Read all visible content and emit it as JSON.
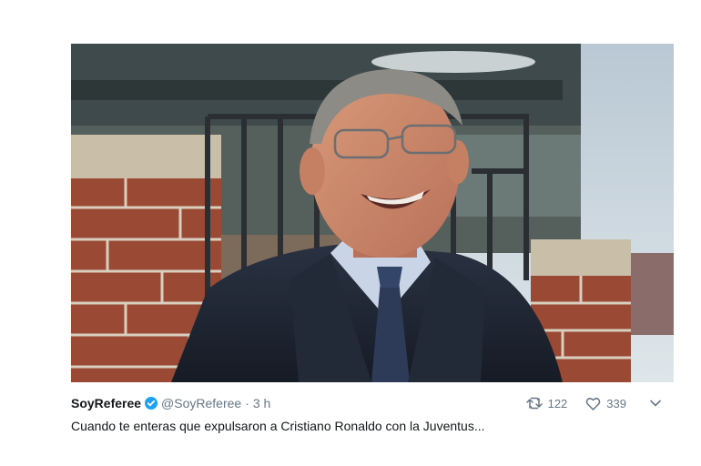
{
  "tweet": {
    "author_name": "SoyReferee",
    "handle": "@SoyReferee",
    "separator": "·",
    "time": "3 h",
    "text": "Cuando te enteras que expulsaron a Cristiano Ronaldo con la Juventus...",
    "retweets": "122",
    "likes": "339"
  },
  "icons": {
    "verified": "verified-badge-icon",
    "retweet": "retweet-icon",
    "like": "heart-icon",
    "more": "chevron-down-icon"
  },
  "colors": {
    "verified": "#1da1f2",
    "muted": "#657786",
    "text": "#14171a"
  }
}
